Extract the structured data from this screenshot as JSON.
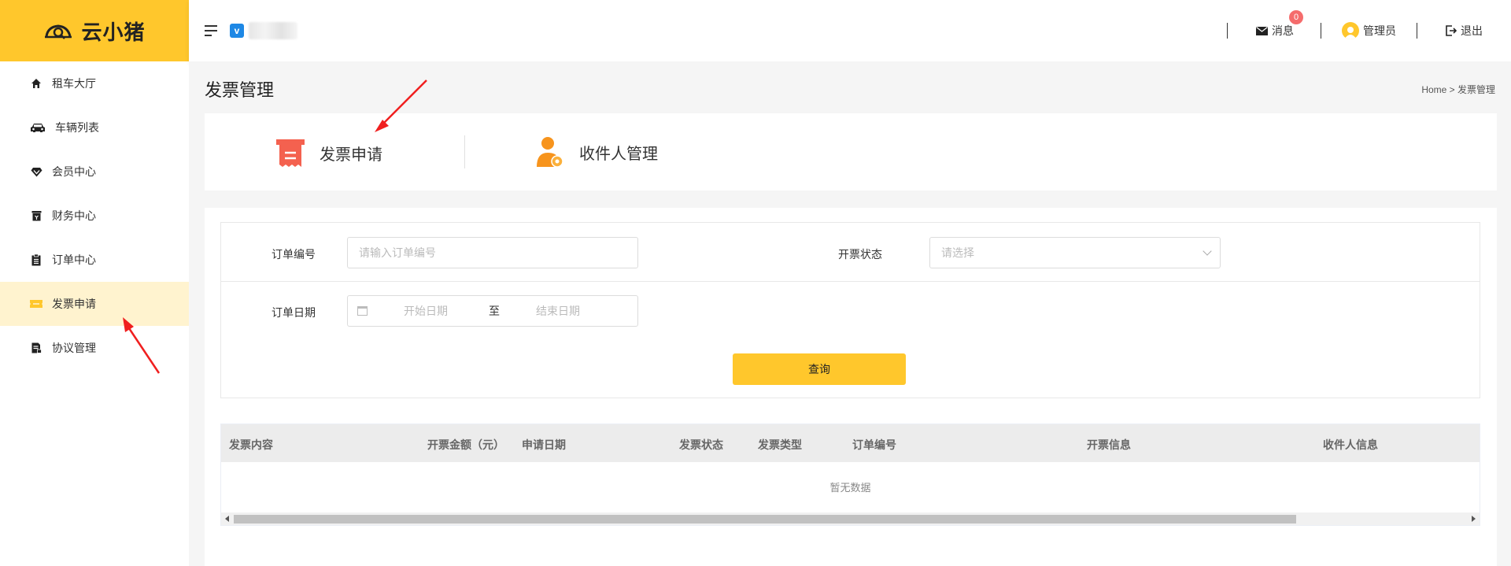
{
  "brand": {
    "name": "云小猪",
    "accent": "#ffc72c"
  },
  "sidebar": {
    "items": [
      {
        "label": "租车大厅",
        "icon": "home-icon",
        "active": false
      },
      {
        "label": "车辆列表",
        "icon": "car-icon",
        "active": false
      },
      {
        "label": "会员中心",
        "icon": "diamond-icon",
        "active": false
      },
      {
        "label": "财务中心",
        "icon": "wallet-icon",
        "active": false
      },
      {
        "label": "订单中心",
        "icon": "clipboard-icon",
        "active": false
      },
      {
        "label": "发票申请",
        "icon": "ticket-icon",
        "active": true
      },
      {
        "label": "协议管理",
        "icon": "document-icon",
        "active": false
      }
    ]
  },
  "header": {
    "vip_label": "v",
    "messages_label": "消息",
    "messages_count": "0",
    "user_label": "管理员",
    "logout_label": "退出"
  },
  "page": {
    "title": "发票管理",
    "breadcrumb": "Home > 发票管理"
  },
  "tabs": [
    {
      "label": "发票申请",
      "icon": "invoice-icon"
    },
    {
      "label": "收件人管理",
      "icon": "user-settings-icon"
    }
  ],
  "search": {
    "order_no_label": "订单编号",
    "order_no_placeholder": "请输入订单编号",
    "invoice_status_label": "开票状态",
    "invoice_status_placeholder": "请选择",
    "order_date_label": "订单日期",
    "start_date_placeholder": "开始日期",
    "date_separator": "至",
    "end_date_placeholder": "结束日期",
    "query_button": "查询"
  },
  "table": {
    "columns": [
      "发票内容",
      "开票金额（元）",
      "申请日期",
      "发票状态",
      "发票类型",
      "订单编号",
      "开票信息",
      "收件人信息"
    ],
    "empty_text": "暂无数据"
  },
  "annotations": {
    "arrow_color": "#f01f1f"
  }
}
